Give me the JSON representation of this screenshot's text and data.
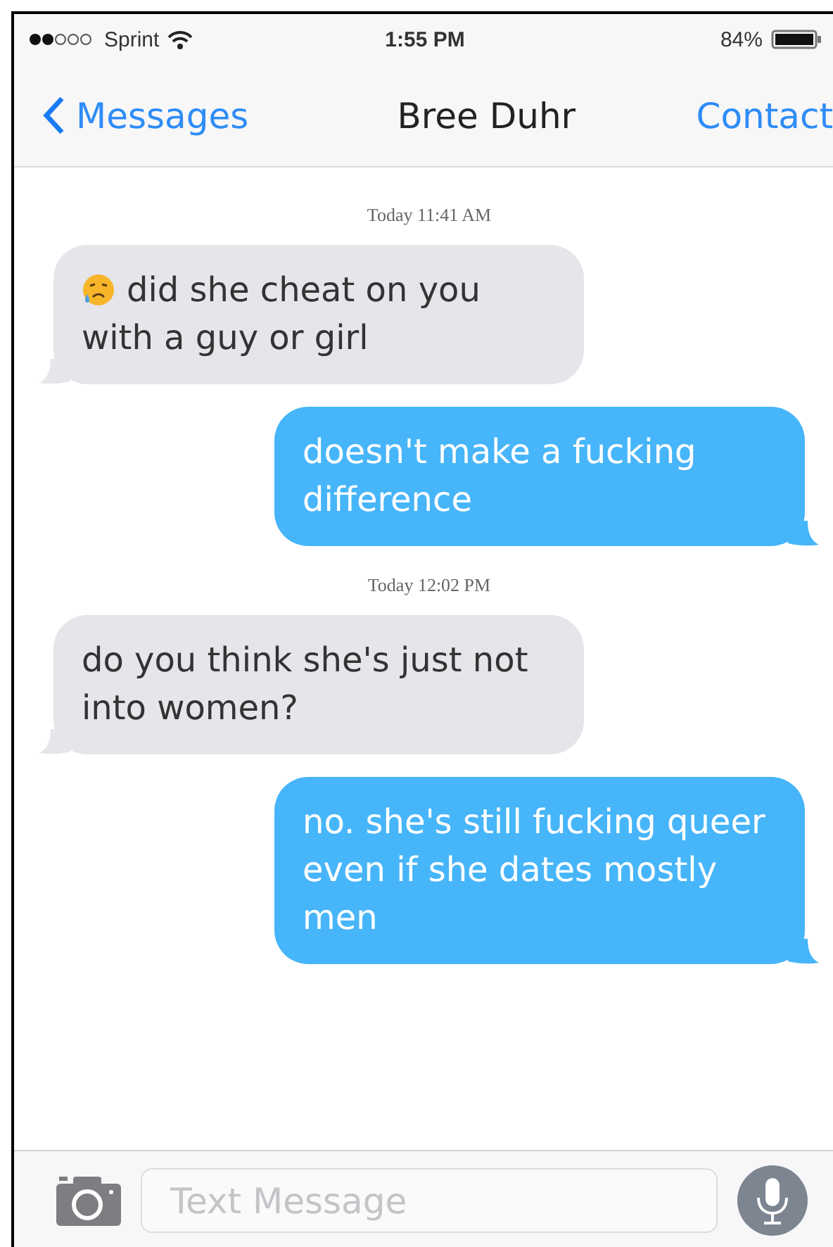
{
  "status_bar": {
    "carrier": "Sprint",
    "time": "1:55 PM",
    "battery": "84%"
  },
  "nav": {
    "back": "Messages",
    "title": "Bree Duhr",
    "action": "Contact"
  },
  "messages": [
    {
      "kind": "time",
      "text": "Today 11:41 AM"
    },
    {
      "kind": "incoming",
      "text": "did she cheat on you with a guy or girl",
      "emoji": true
    },
    {
      "kind": "outgoing",
      "text": "doesn't make a fucking difference"
    },
    {
      "kind": "time",
      "text": "Today 12:02 PM"
    },
    {
      "kind": "incoming",
      "text": "do you think she's just not into women?"
    },
    {
      "kind": "outgoing",
      "text": "no. she's still fucking queer even if she dates mostly men"
    }
  ],
  "composer": {
    "placeholder": "Text Message"
  }
}
